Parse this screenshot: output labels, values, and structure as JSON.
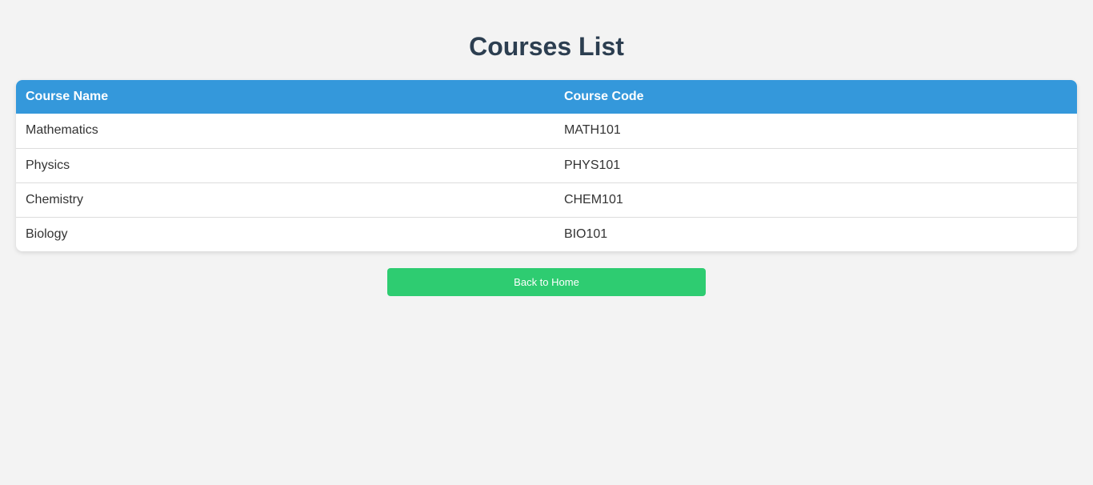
{
  "page": {
    "title": "Courses List"
  },
  "table": {
    "columns": [
      "Course Name",
      "Course Code"
    ],
    "rows": [
      {
        "name": "Mathematics",
        "code": "MATH101"
      },
      {
        "name": "Physics",
        "code": "PHYS101"
      },
      {
        "name": "Chemistry",
        "code": "CHEM101"
      },
      {
        "name": "Biology",
        "code": "BIO101"
      }
    ]
  },
  "actions": {
    "back_label": "Back to Home"
  },
  "colors": {
    "header_bg": "#3498db",
    "button_bg": "#2ecc71",
    "title_text": "#2c3e50",
    "page_bg": "#f3f3f3"
  }
}
